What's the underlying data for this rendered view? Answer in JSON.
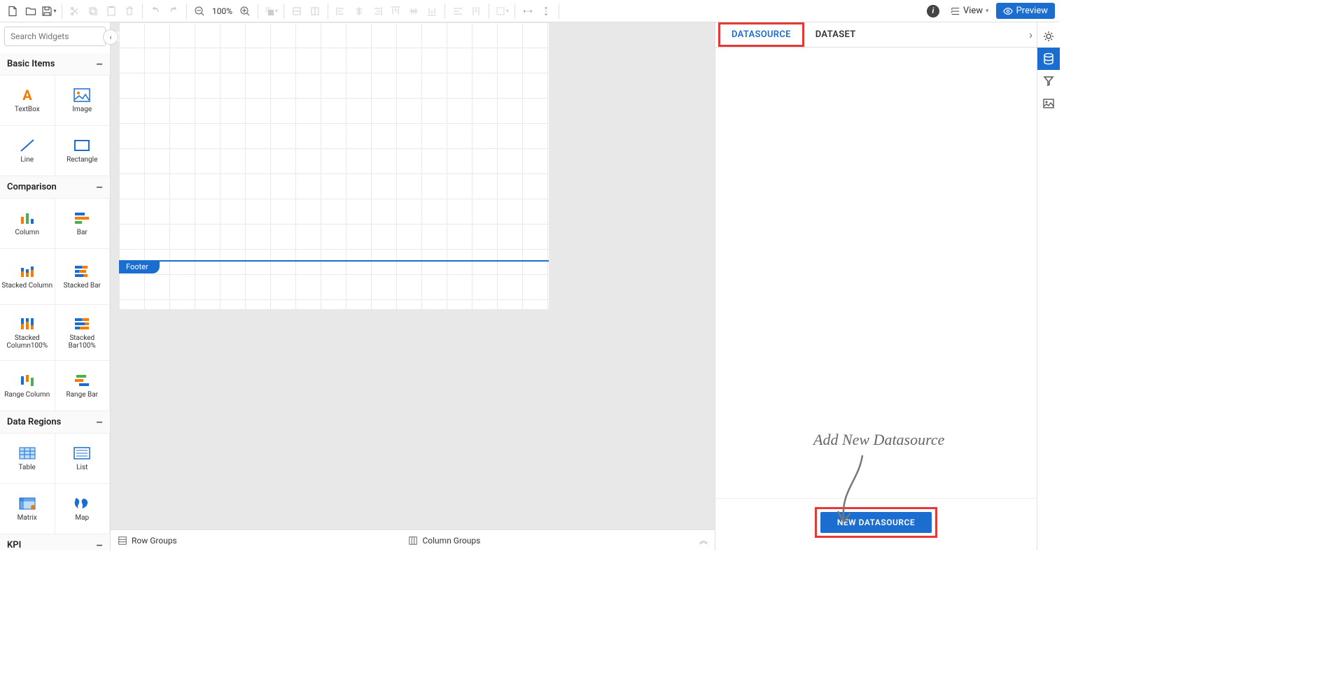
{
  "toolbar": {
    "zoom": "100%",
    "view_label": "View",
    "preview_label": "Preview"
  },
  "search": {
    "placeholder": "Search Widgets"
  },
  "categories": {
    "basic": {
      "title": "Basic Items",
      "items": [
        "TextBox",
        "Image",
        "Line",
        "Rectangle"
      ]
    },
    "comparison": {
      "title": "Comparison",
      "items": [
        "Column",
        "Bar",
        "Stacked Column",
        "Stacked Bar",
        "Stacked Column100%",
        "Stacked Bar100%",
        "Range Column",
        "Range Bar"
      ]
    },
    "dataregions": {
      "title": "Data Regions",
      "items": [
        "Table",
        "List",
        "Matrix",
        "Map"
      ]
    },
    "kpi": {
      "title": "KPI"
    }
  },
  "canvas": {
    "footer_label": "Footer"
  },
  "groups": {
    "row": "Row Groups",
    "column": "Column Groups"
  },
  "right": {
    "tab_datasource": "DATASOURCE",
    "tab_dataset": "DATASET",
    "hint": "Add New Datasource",
    "new_button": "NEW DATASOURCE"
  }
}
